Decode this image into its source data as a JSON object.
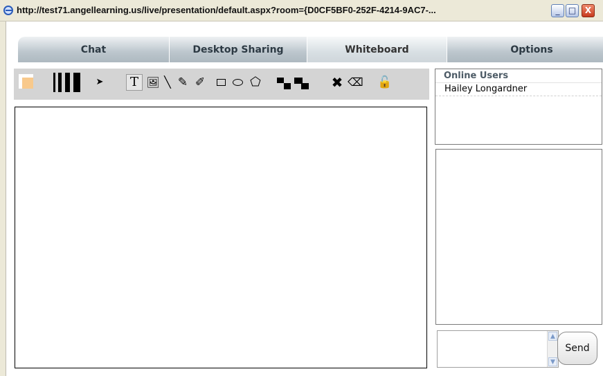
{
  "window": {
    "title_url": "http://test71.angellearning.us/live/presentation/default.aspx?room={D0CF5BF0-252F-4214-9AC7-...",
    "minimize_icon": "_",
    "maximize_icon": "□",
    "close_icon": "X"
  },
  "tabs": [
    {
      "label": "Chat",
      "width": 219
    },
    {
      "label": "Desktop Sharing",
      "width": 199
    },
    {
      "label": "Whiteboard",
      "width": 202
    },
    {
      "label": "Options",
      "width": 244
    }
  ],
  "tabs_active": "Whiteboard",
  "toolbar": {
    "fill_color": "#f8c98c",
    "tools": {
      "select": "➤",
      "text": "T",
      "image": "🖼",
      "line": "╲",
      "pen": "✎",
      "brush": "✐",
      "polygon": "⬠",
      "delete": "✖",
      "eraser": "⌫",
      "lock": "🔓"
    }
  },
  "online_users": {
    "header": "Online Users",
    "users": [
      "Hailey Longardner"
    ]
  },
  "chat": {
    "send_label": "Send",
    "message_value": ""
  }
}
